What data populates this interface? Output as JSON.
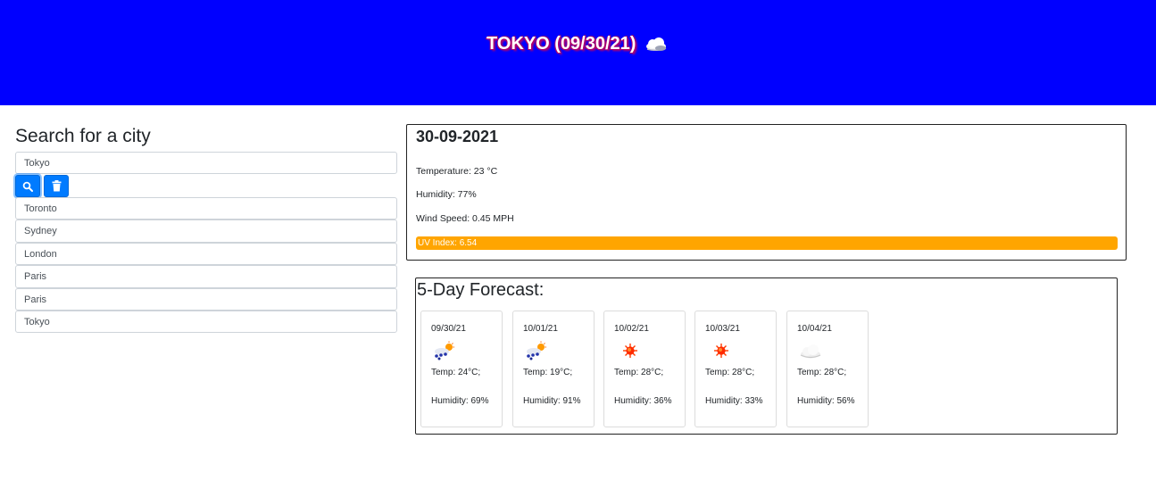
{
  "header": {
    "title": "TOKYO (09/30/21)",
    "icon": "cloud-icon",
    "bg_color": "#0000ff"
  },
  "search": {
    "heading": "Search for a city",
    "input_value": "Tokyo",
    "search_button_icon": "search-icon",
    "delete_button_icon": "trash-icon",
    "history": [
      "Toronto",
      "Sydney",
      "London",
      "Paris",
      "Paris",
      "Tokyo"
    ]
  },
  "current": {
    "date": "30-09-2021",
    "temperature": "Temperature: 23 °C",
    "humidity": "Humidity: 77%",
    "wind": "Wind Speed: 0.45 MPH",
    "uv": "UV Index: 6.54",
    "uv_color": "#ffa500"
  },
  "forecast": {
    "heading": "5-Day Forecast:",
    "days": [
      {
        "date": "09/30/21",
        "icon": "rain-sun-icon",
        "temp": "Temp: 24°C;",
        "humidity": "Humidity: 69%"
      },
      {
        "date": "10/01/21",
        "icon": "rain-sun-icon",
        "temp": "Temp: 19°C;",
        "humidity": "Humidity: 91%"
      },
      {
        "date": "10/02/21",
        "icon": "sun-icon",
        "temp": "Temp: 28°C;",
        "humidity": "Humidity: 36%"
      },
      {
        "date": "10/03/21",
        "icon": "sun-icon",
        "temp": "Temp: 28°C;",
        "humidity": "Humidity: 33%"
      },
      {
        "date": "10/04/21",
        "icon": "cloud-icon",
        "temp": "Temp: 28°C;",
        "humidity": "Humidity: 56%"
      }
    ]
  }
}
